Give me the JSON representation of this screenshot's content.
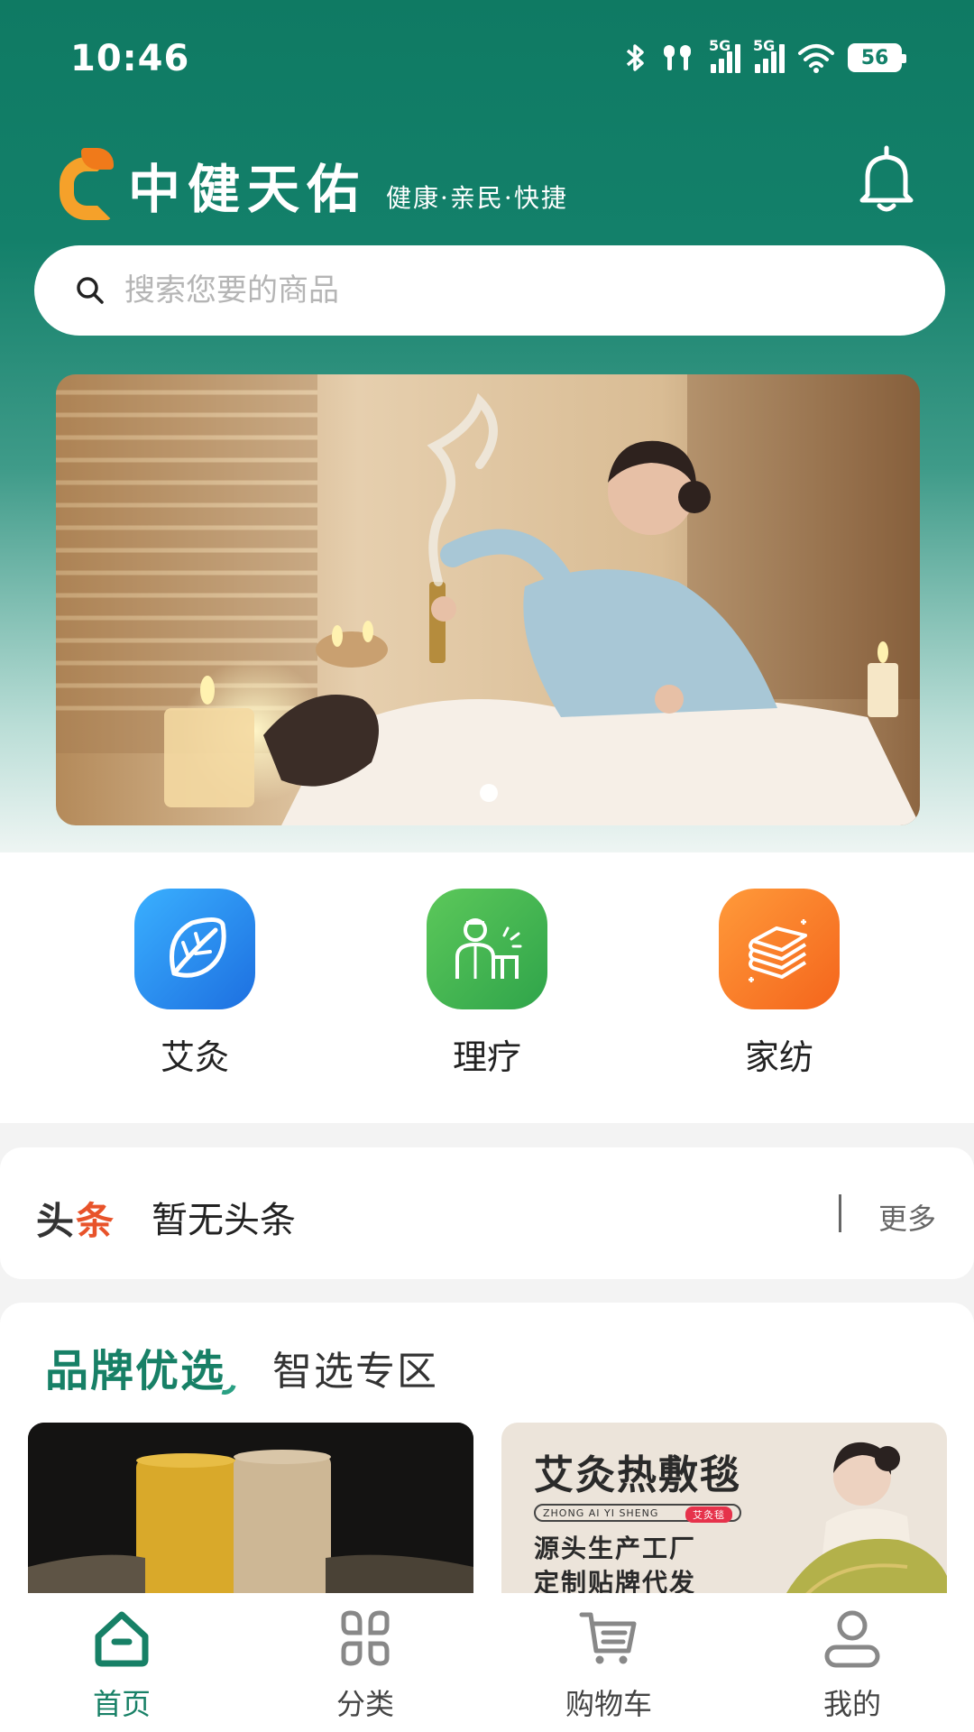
{
  "status_bar": {
    "time": "10:46",
    "network_1": "5G",
    "network_2": "5G",
    "battery": "56"
  },
  "header": {
    "brand_name": "中健天佑",
    "slogan": "健康·亲民·快捷",
    "icons": [
      "logo-mark",
      "bell-icon"
    ]
  },
  "search": {
    "placeholder": "搜索您要的商品"
  },
  "banner": {
    "slides_count": 1,
    "active_slide": 1
  },
  "categories": [
    {
      "label": "艾灸",
      "icon": "leaf-icon",
      "color": "#2a8ef0"
    },
    {
      "label": "理疗",
      "icon": "therapist-icon",
      "color": "#46b04a"
    },
    {
      "label": "家纺",
      "icon": "folded-textile-icon",
      "color": "#fb7d22"
    }
  ],
  "headline": {
    "logo_part1": "头",
    "logo_part2": "条",
    "text": "暂无头条",
    "more": "更多"
  },
  "brand_section": {
    "tab_active": "品牌优选",
    "tab_other": "智选专区",
    "cards": [
      {
        "name": "moxa-rolls-card"
      },
      {
        "title": "艾灸热敷毯",
        "tag_text": "ZHONG AI YI SHENG",
        "tag_badge": "艾灸毯",
        "line1": "源头生产工厂",
        "line2": "定制贴牌代发"
      }
    ]
  },
  "bottom_nav": [
    {
      "label": "首页",
      "icon": "home-icon",
      "active": true
    },
    {
      "label": "分类",
      "icon": "category-icon",
      "active": false
    },
    {
      "label": "购物车",
      "icon": "cart-icon",
      "active": false
    },
    {
      "label": "我的",
      "icon": "profile-icon",
      "active": false
    }
  ],
  "colors": {
    "brand_green": "#178066",
    "header_green": "#0f7a63"
  }
}
